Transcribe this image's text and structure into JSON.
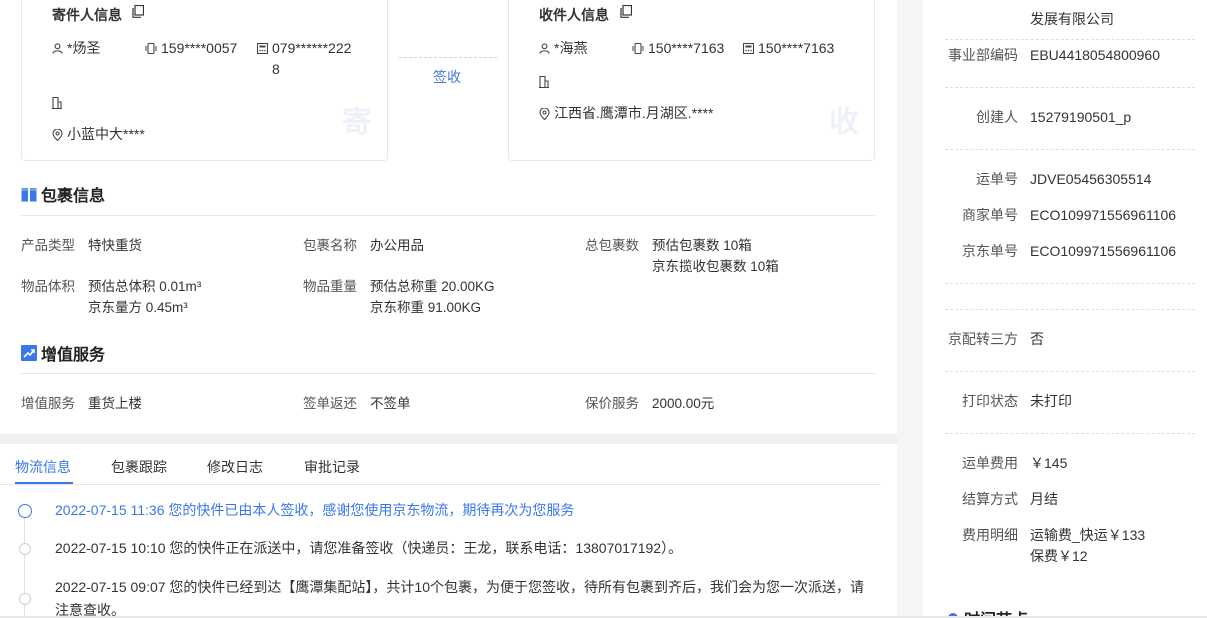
{
  "sender": {
    "title": "寄件人信息",
    "name": "*炀圣",
    "mobile": "159****0057",
    "phone_line1": "079******222",
    "phone_line2": "8",
    "address": "小蓝中大****",
    "mark": "寄"
  },
  "receiver": {
    "title": "收件人信息",
    "name": "*海燕",
    "mobile": "150****7163",
    "phone": "150****7163",
    "address": "江西省.鹰潭市.月湖区.****",
    "mark": "收"
  },
  "connector_label": "签收",
  "package": {
    "title": "包裹信息",
    "product_type_label": "产品类型",
    "product_type": "特快重货",
    "package_name_label": "包裹名称",
    "package_name": "办公用品",
    "total_count_label": "总包裹数",
    "total_count_line1": "预估包裹数 10箱",
    "total_count_line2": "京东揽收包裹数 10箱",
    "volume_label": "物品体积",
    "volume_line1": "预估总体积 0.01m³",
    "volume_line2": "京东量方 0.45m³",
    "weight_label": "物品重量",
    "weight_line1": "预估总称重 20.00KG",
    "weight_line2": "京东称重 91.00KG"
  },
  "value_added": {
    "title": "增值服务",
    "service_label": "增值服务",
    "service": "重货上楼",
    "receipt_label": "签单返还",
    "receipt": "不签单",
    "insurance_label": "保价服务",
    "insurance": "2000.00元"
  },
  "tabs": [
    "物流信息",
    "包裹跟踪",
    "修改日志",
    "审批记录"
  ],
  "timeline": [
    {
      "text": "2022-07-15 11:36 您的快件已由本人签收，感谢您使用京东物流，期待再次为您服务"
    },
    {
      "text": "2022-07-15 10:10 您的快件正在派送中，请您准备签收（快递员：王龙，联系电话：13807017192）。"
    },
    {
      "text": "2022-07-15 09:07 您的快件已经到达【鹰潭集配站】，共计10个包裹，为便于您签收，待所有包裹到齐后，我们会为您一次派送，请注意查收。"
    }
  ],
  "right_panel": {
    "company_tail": "发展有限公司",
    "dept_code_label": "事业部编码",
    "dept_code": "EBU4418054800960",
    "creator_label": "创建人",
    "creator": "15279190501_p",
    "waybill_label": "运单号",
    "waybill": "JDVE05456305514",
    "merchant_no_label": "商家单号",
    "merchant_no": "ECO109971556961106",
    "jd_no_label": "京东单号",
    "jd_no": "ECO109971556961106",
    "third_party_label": "京配转三方",
    "third_party": "否",
    "print_label": "打印状态",
    "print_status": "未打印",
    "fee_label": "运单费用",
    "fee": "￥145",
    "settle_label": "结算方式",
    "settle": "月结",
    "fee_detail_label": "费用明细",
    "fee_detail_line1": "运输费_快运￥133",
    "fee_detail_line2": "保费￥12",
    "next_section": "时间节点"
  },
  "colors": {
    "accent": "#3b78e7",
    "border": "#e6e9f0"
  }
}
